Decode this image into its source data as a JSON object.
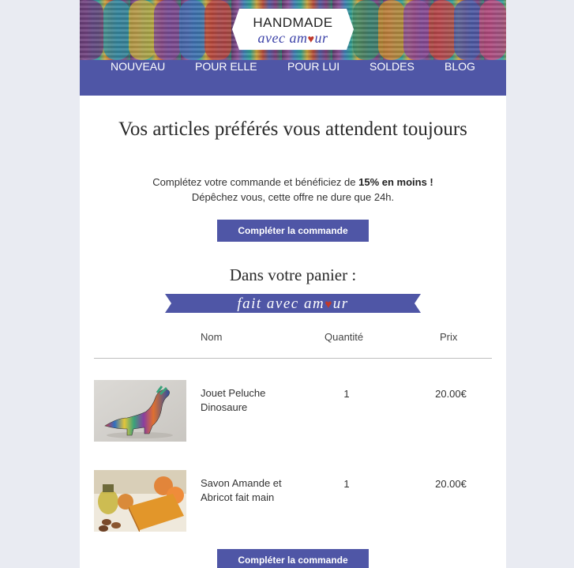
{
  "header": {
    "logo_top": "HANDMADE",
    "logo_bottom": "avec amour"
  },
  "nav": {
    "items": [
      "NOUVEAU",
      "POUR ELLE",
      "POUR LUI",
      "SOLDES",
      "BLOG"
    ]
  },
  "hero_text": {
    "title": "Vos articles préférés vous attendent toujours",
    "line1_prefix": "Complétez votre commande et bénéficiez de ",
    "line1_bold": "15% en moins !",
    "line2": "Dépêchez vous, cette offre ne dure que 24h."
  },
  "cta": {
    "label": "Compléter la commande"
  },
  "cart": {
    "title": "Dans votre panier :",
    "ribbon": "fait avec amour",
    "headers": {
      "name": "Nom",
      "quantity": "Quantité",
      "price": "Prix"
    },
    "items": [
      {
        "name": "Jouet Peluche Dinosaure",
        "quantity": "1",
        "price": "20.00€"
      },
      {
        "name": "Savon Amande et Abricot fait main",
        "quantity": "1",
        "price": "20.00€"
      }
    ]
  },
  "colors": {
    "brand": "#4f56a6",
    "heart": "#c0392b",
    "page_bg": "#e9ebf2"
  }
}
